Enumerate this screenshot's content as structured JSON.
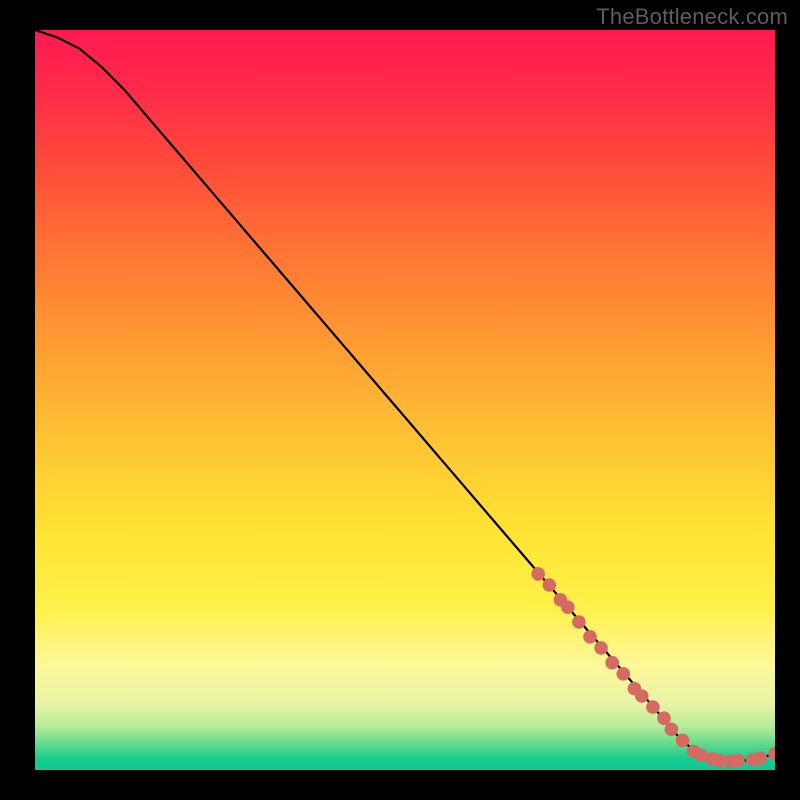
{
  "watermark": "TheBottleneck.com",
  "chart_data": {
    "type": "line",
    "title": "",
    "xlabel": "",
    "ylabel": "",
    "xlim": [
      0,
      100
    ],
    "ylim": [
      0,
      100
    ],
    "curve": {
      "x": [
        0,
        3,
        6,
        9,
        12,
        15,
        18,
        21,
        24,
        27,
        30,
        33,
        36,
        39,
        42,
        45,
        48,
        51,
        54,
        57,
        60,
        63,
        66,
        69,
        72,
        75,
        78,
        81,
        84,
        86,
        88,
        90,
        92,
        94,
        96,
        98,
        100
      ],
      "y": [
        100,
        99,
        97.5,
        95,
        92,
        88.5,
        85,
        81.5,
        78,
        74.5,
        71,
        67.5,
        64,
        60.5,
        57,
        53.5,
        50,
        46.5,
        43,
        39.5,
        36,
        32.5,
        29,
        25.5,
        22,
        18.5,
        15,
        11.5,
        8,
        5.5,
        3.5,
        2,
        1.2,
        1.2,
        1.3,
        1.6,
        2.2
      ]
    },
    "markers": [
      {
        "x": 68.0,
        "y": 26.5
      },
      {
        "x": 69.5,
        "y": 25.0
      },
      {
        "x": 71.0,
        "y": 23.0
      },
      {
        "x": 72.0,
        "y": 22.0
      },
      {
        "x": 73.5,
        "y": 20.0
      },
      {
        "x": 75.0,
        "y": 18.0
      },
      {
        "x": 76.5,
        "y": 16.5
      },
      {
        "x": 78.0,
        "y": 14.5
      },
      {
        "x": 79.5,
        "y": 13.0
      },
      {
        "x": 81.0,
        "y": 11.0
      },
      {
        "x": 82.0,
        "y": 10.0
      },
      {
        "x": 83.5,
        "y": 8.5
      },
      {
        "x": 85.0,
        "y": 7.0
      },
      {
        "x": 86.0,
        "y": 5.5
      },
      {
        "x": 87.5,
        "y": 4.0
      },
      {
        "x": 89.0,
        "y": 2.5
      },
      {
        "x": 90.0,
        "y": 2.0
      },
      {
        "x": 91.5,
        "y": 1.5
      },
      {
        "x": 92.5,
        "y": 1.3
      },
      {
        "x": 94.0,
        "y": 1.2
      },
      {
        "x": 95.0,
        "y": 1.3
      },
      {
        "x": 97.0,
        "y": 1.4
      },
      {
        "x": 98.0,
        "y": 1.6
      },
      {
        "x": 100.0,
        "y": 2.2
      }
    ],
    "gradient_stops": [
      {
        "pct": 0.0,
        "color": "#ff1a4f"
      },
      {
        "pct": 0.08,
        "color": "#ff2a49"
      },
      {
        "pct": 0.18,
        "color": "#ff4a3a"
      },
      {
        "pct": 0.3,
        "color": "#ff7534"
      },
      {
        "pct": 0.42,
        "color": "#ff9a33"
      },
      {
        "pct": 0.55,
        "color": "#ffc233"
      },
      {
        "pct": 0.68,
        "color": "#ffe433"
      },
      {
        "pct": 0.78,
        "color": "#fff04a"
      },
      {
        "pct": 0.86,
        "color": "#fdf89a"
      },
      {
        "pct": 0.91,
        "color": "#e8f4a4"
      },
      {
        "pct": 0.94,
        "color": "#b8ec9a"
      },
      {
        "pct": 0.965,
        "color": "#63da8c"
      },
      {
        "pct": 0.985,
        "color": "#16cc8e"
      },
      {
        "pct": 1.0,
        "color": "#0ec995"
      }
    ],
    "marker_color": "#d46a62",
    "curve_color": "#000000"
  }
}
